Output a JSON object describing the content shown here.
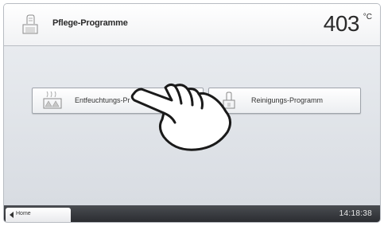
{
  "header": {
    "title": "Pflege-Programme",
    "temperature": "403",
    "temperature_unit": "°C",
    "icon": "furnace-icon"
  },
  "programs": [
    {
      "label": "Entfeuchtungs-Pr",
      "icon": "dehumidify-icon"
    },
    {
      "label": "Reinigungs-Programm",
      "icon": "cleaning-icon"
    }
  ],
  "footer": {
    "home_label": "Home",
    "time": "14:18:38"
  },
  "overlay": {
    "icon": "pointing-hand-icon"
  }
}
